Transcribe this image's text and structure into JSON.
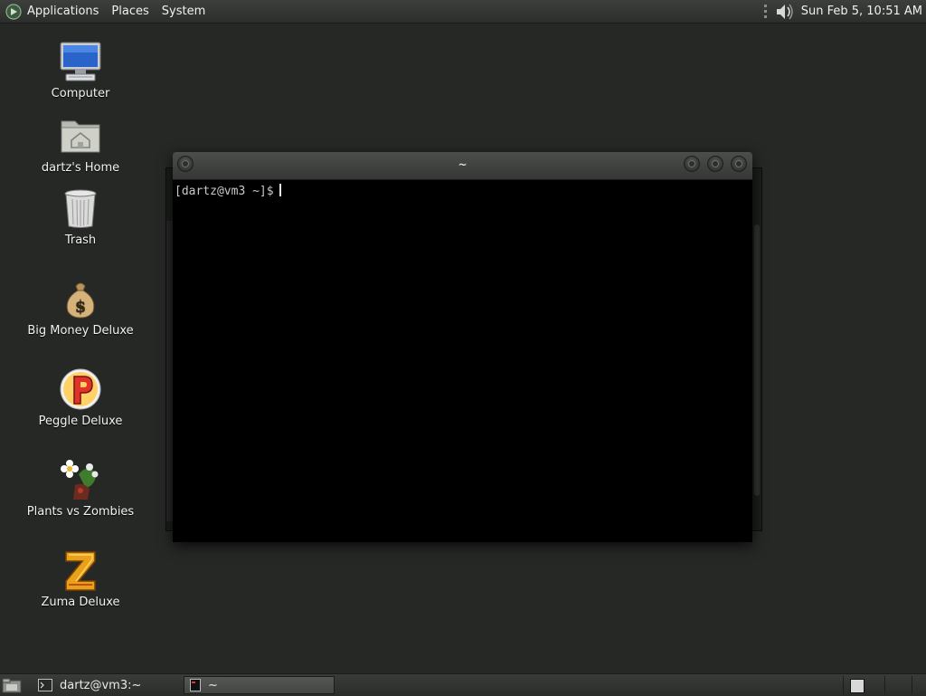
{
  "top_panel": {
    "menus": [
      {
        "label": "Applications"
      },
      {
        "label": "Places"
      },
      {
        "label": "System"
      }
    ],
    "clock": "Sun Feb  5, 10:51 AM"
  },
  "desktop": {
    "icons": [
      {
        "label": "Computer",
        "icon": "computer-icon"
      },
      {
        "label": "dartz's Home",
        "icon": "home-folder-icon"
      },
      {
        "label": "Trash",
        "icon": "trash-icon"
      },
      {
        "label": "Big Money Deluxe",
        "icon": "money-bag-icon"
      },
      {
        "label": "Peggle Deluxe",
        "icon": "peggle-icon"
      },
      {
        "label": "Plants vs Zombies",
        "icon": "plants-vs-zombies-icon"
      },
      {
        "label": "Zuma Deluxe",
        "icon": "zuma-icon"
      }
    ]
  },
  "terminal": {
    "title": "~",
    "prompt": "[dartz@vm3 ~]$"
  },
  "bottom_panel": {
    "tasks": [
      {
        "label": "dartz@vm3:~"
      },
      {
        "label": "~"
      }
    ]
  },
  "colors": {
    "desktop_bg": "#262826",
    "panel_bg": "#333533",
    "terminal_bg": "#000000"
  }
}
